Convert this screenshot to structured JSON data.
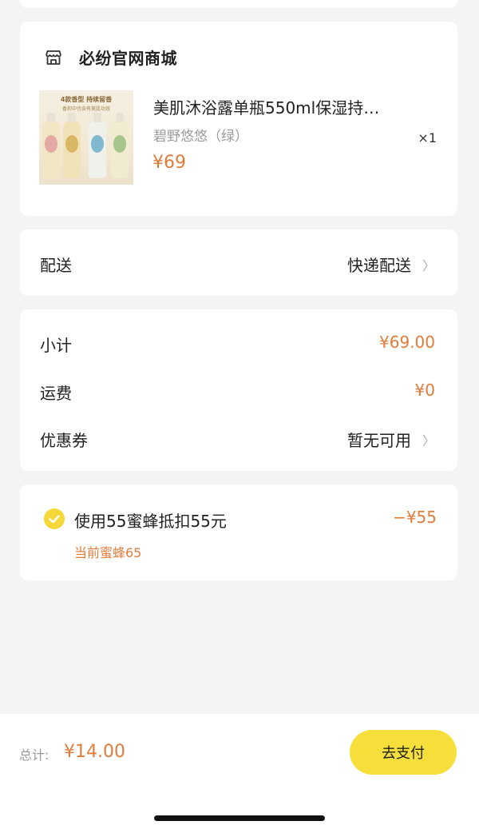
{
  "shop": {
    "name": "必纷官网商城",
    "icon": "store-icon"
  },
  "product": {
    "title": "美肌沐浴露单瓶550ml保湿持…",
    "variant": "碧野悠悠（绿）",
    "price": "¥69",
    "quantity": "×1",
    "image_banner": "4款香型 持续留香",
    "image_subbanner": "香和中也含有美肌功效"
  },
  "delivery": {
    "label": "配送",
    "value": "快递配送",
    "chevron": "〉"
  },
  "summary": {
    "subtotal_label": "小计",
    "subtotal_value": "¥69.00",
    "shipping_label": "运费",
    "shipping_value": "¥0",
    "coupon_label": "优惠券",
    "coupon_value": "暂无可用",
    "chevron": "〉"
  },
  "bee": {
    "label": "使用55蜜蜂抵扣55元",
    "discount": "−¥55",
    "current": "当前蜜蜂65",
    "checked": true
  },
  "footer": {
    "total_label": "总计:",
    "total_value": "¥14.00",
    "pay_label": "去支付"
  },
  "colors": {
    "accent": "#e07c3a",
    "pay_button": "#f6df3b",
    "check": "#f4d83a"
  }
}
